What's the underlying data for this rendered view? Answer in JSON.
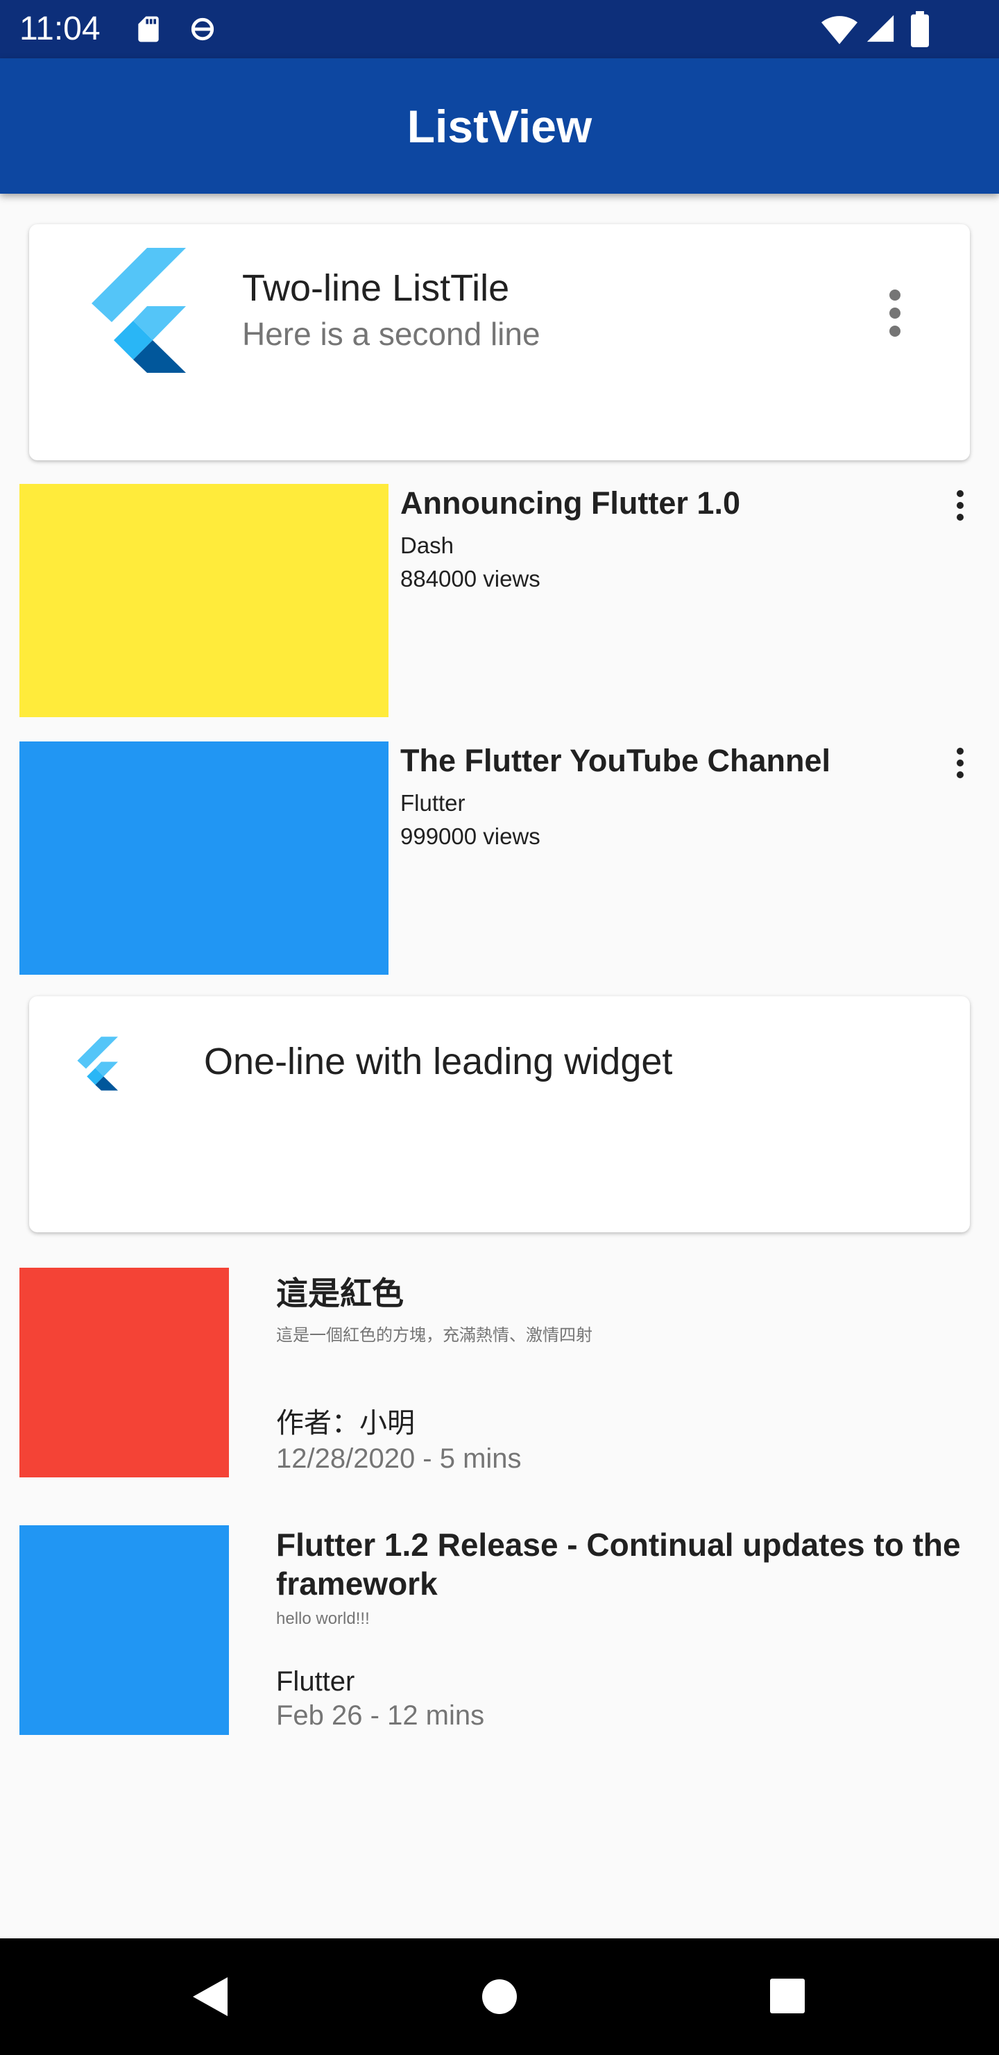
{
  "status_bar": {
    "time": "11:04",
    "icons_left": [
      "sd-card-icon",
      "sync-icon"
    ],
    "icons_right": [
      "wifi-icon",
      "signal-icon",
      "battery-icon"
    ]
  },
  "app_bar": {
    "title": "ListView",
    "color": "#0d47a1"
  },
  "tiles": [
    {
      "title": "Two-line ListTile",
      "subtitle": "Here is a second line",
      "leading_icon": "flutter-logo-icon",
      "trailing_icon": "more-vert-icon"
    },
    {
      "title": "One-line with leading widget",
      "leading_icon": "flutter-logo-icon"
    }
  ],
  "videos": [
    {
      "title": "Announcing Flutter 1.0",
      "user": "Dash",
      "views": "884000 views",
      "thumb_color": "#ffeb3b"
    },
    {
      "title": "The Flutter YouTube Channel",
      "user": "Flutter",
      "views": "999000 views",
      "thumb_color": "#2196f3"
    }
  ],
  "articles": [
    {
      "title": "這是紅色",
      "subtitle": "這是一個紅色的方塊，充滿熱情、激情四射",
      "author": "作者：小明",
      "date": "12/28/2020 - 5 mins",
      "thumb_color": "#f44336"
    },
    {
      "title": "Flutter 1.2 Release - Continual updates to the framework",
      "subtitle": "hello world!!!",
      "author": "Flutter",
      "date": "Feb 26 - 12 mins",
      "thumb_color": "#2196f3"
    }
  ],
  "nav_bar": {
    "buttons": [
      "back-icon",
      "home-icon",
      "recents-icon"
    ]
  }
}
